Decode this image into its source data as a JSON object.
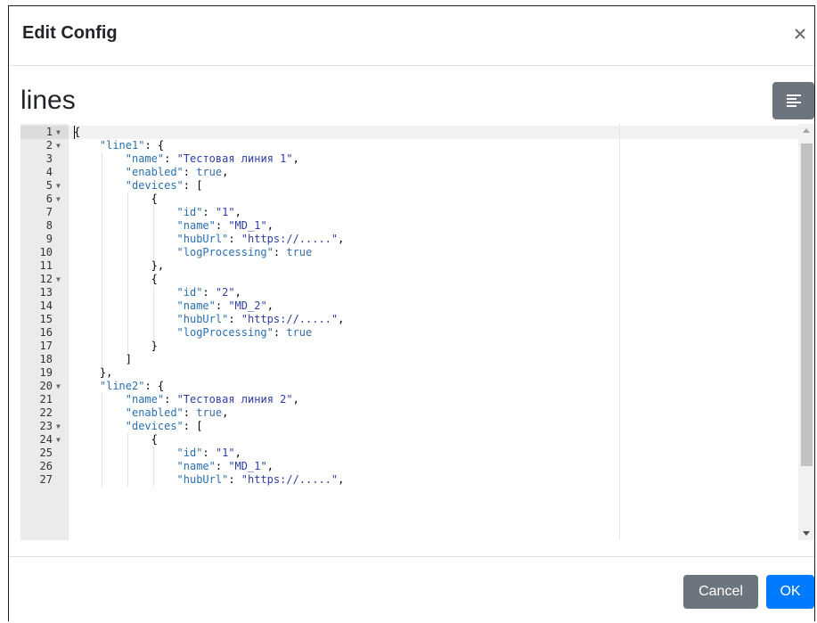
{
  "dialog": {
    "title": "Edit Config",
    "close_glyph": "×",
    "section_title": "lines",
    "format_button_icon": "align-left-icon",
    "cancel_label": "Cancel",
    "ok_label": "OK"
  },
  "colors": {
    "secondary": "#6c757d",
    "primary": "#007bff",
    "json_key": "#2a6fae",
    "json_string": "#2e3da0",
    "gutter": "#ebebeb"
  },
  "editor": {
    "lines": [
      {
        "num": "1",
        "fold": true,
        "indent": 0,
        "tokens": [
          {
            "t": "p",
            "v": "{"
          }
        ]
      },
      {
        "num": "2",
        "fold": true,
        "indent": 1,
        "tokens": [
          {
            "t": "k",
            "v": "\"line1\""
          },
          {
            "t": "p",
            "v": ": {"
          }
        ]
      },
      {
        "num": "3",
        "fold": false,
        "indent": 2,
        "tokens": [
          {
            "t": "k",
            "v": "\"name\""
          },
          {
            "t": "p",
            "v": ": "
          },
          {
            "t": "s",
            "v": "\"Тестовая линия 1\""
          },
          {
            "t": "p",
            "v": ","
          }
        ]
      },
      {
        "num": "4",
        "fold": false,
        "indent": 2,
        "tokens": [
          {
            "t": "k",
            "v": "\"enabled\""
          },
          {
            "t": "p",
            "v": ": "
          },
          {
            "t": "b",
            "v": "true"
          },
          {
            "t": "p",
            "v": ","
          }
        ]
      },
      {
        "num": "5",
        "fold": true,
        "indent": 2,
        "tokens": [
          {
            "t": "k",
            "v": "\"devices\""
          },
          {
            "t": "p",
            "v": ": ["
          }
        ]
      },
      {
        "num": "6",
        "fold": true,
        "indent": 3,
        "tokens": [
          {
            "t": "p",
            "v": "{"
          }
        ]
      },
      {
        "num": "7",
        "fold": false,
        "indent": 4,
        "tokens": [
          {
            "t": "k",
            "v": "\"id\""
          },
          {
            "t": "p",
            "v": ": "
          },
          {
            "t": "s",
            "v": "\"1\""
          },
          {
            "t": "p",
            "v": ","
          }
        ]
      },
      {
        "num": "8",
        "fold": false,
        "indent": 4,
        "tokens": [
          {
            "t": "k",
            "v": "\"name\""
          },
          {
            "t": "p",
            "v": ": "
          },
          {
            "t": "s",
            "v": "\"MD_1\""
          },
          {
            "t": "p",
            "v": ","
          }
        ]
      },
      {
        "num": "9",
        "fold": false,
        "indent": 4,
        "tokens": [
          {
            "t": "k",
            "v": "\"hubUrl\""
          },
          {
            "t": "p",
            "v": ": "
          },
          {
            "t": "s",
            "v": "\"https://.....\""
          },
          {
            "t": "p",
            "v": ","
          }
        ]
      },
      {
        "num": "10",
        "fold": false,
        "indent": 4,
        "tokens": [
          {
            "t": "k",
            "v": "\"logProcessing\""
          },
          {
            "t": "p",
            "v": ": "
          },
          {
            "t": "b",
            "v": "true"
          }
        ]
      },
      {
        "num": "11",
        "fold": false,
        "indent": 3,
        "tokens": [
          {
            "t": "p",
            "v": "},"
          }
        ]
      },
      {
        "num": "12",
        "fold": true,
        "indent": 3,
        "tokens": [
          {
            "t": "p",
            "v": "{"
          }
        ]
      },
      {
        "num": "13",
        "fold": false,
        "indent": 4,
        "tokens": [
          {
            "t": "k",
            "v": "\"id\""
          },
          {
            "t": "p",
            "v": ": "
          },
          {
            "t": "s",
            "v": "\"2\""
          },
          {
            "t": "p",
            "v": ","
          }
        ]
      },
      {
        "num": "14",
        "fold": false,
        "indent": 4,
        "tokens": [
          {
            "t": "k",
            "v": "\"name\""
          },
          {
            "t": "p",
            "v": ": "
          },
          {
            "t": "s",
            "v": "\"MD_2\""
          },
          {
            "t": "p",
            "v": ","
          }
        ]
      },
      {
        "num": "15",
        "fold": false,
        "indent": 4,
        "tokens": [
          {
            "t": "k",
            "v": "\"hubUrl\""
          },
          {
            "t": "p",
            "v": ": "
          },
          {
            "t": "s",
            "v": "\"https://.....\""
          },
          {
            "t": "p",
            "v": ","
          }
        ]
      },
      {
        "num": "16",
        "fold": false,
        "indent": 4,
        "tokens": [
          {
            "t": "k",
            "v": "\"logProcessing\""
          },
          {
            "t": "p",
            "v": ": "
          },
          {
            "t": "b",
            "v": "true"
          }
        ]
      },
      {
        "num": "17",
        "fold": false,
        "indent": 3,
        "tokens": [
          {
            "t": "p",
            "v": "}"
          }
        ]
      },
      {
        "num": "18",
        "fold": false,
        "indent": 2,
        "tokens": [
          {
            "t": "p",
            "v": "]"
          }
        ]
      },
      {
        "num": "19",
        "fold": false,
        "indent": 1,
        "tokens": [
          {
            "t": "p",
            "v": "},"
          }
        ]
      },
      {
        "num": "20",
        "fold": true,
        "indent": 1,
        "tokens": [
          {
            "t": "k",
            "v": "\"line2\""
          },
          {
            "t": "p",
            "v": ": {"
          }
        ]
      },
      {
        "num": "21",
        "fold": false,
        "indent": 2,
        "tokens": [
          {
            "t": "k",
            "v": "\"name\""
          },
          {
            "t": "p",
            "v": ": "
          },
          {
            "t": "s",
            "v": "\"Тестовая линия 2\""
          },
          {
            "t": "p",
            "v": ","
          }
        ]
      },
      {
        "num": "22",
        "fold": false,
        "indent": 2,
        "tokens": [
          {
            "t": "k",
            "v": "\"enabled\""
          },
          {
            "t": "p",
            "v": ": "
          },
          {
            "t": "b",
            "v": "true"
          },
          {
            "t": "p",
            "v": ","
          }
        ]
      },
      {
        "num": "23",
        "fold": true,
        "indent": 2,
        "tokens": [
          {
            "t": "k",
            "v": "\"devices\""
          },
          {
            "t": "p",
            "v": ": ["
          }
        ]
      },
      {
        "num": "24",
        "fold": true,
        "indent": 3,
        "tokens": [
          {
            "t": "p",
            "v": "{"
          }
        ]
      },
      {
        "num": "25",
        "fold": false,
        "indent": 4,
        "tokens": [
          {
            "t": "k",
            "v": "\"id\""
          },
          {
            "t": "p",
            "v": ": "
          },
          {
            "t": "s",
            "v": "\"1\""
          },
          {
            "t": "p",
            "v": ","
          }
        ]
      },
      {
        "num": "26",
        "fold": false,
        "indent": 4,
        "tokens": [
          {
            "t": "k",
            "v": "\"name\""
          },
          {
            "t": "p",
            "v": ": "
          },
          {
            "t": "s",
            "v": "\"MD_1\""
          },
          {
            "t": "p",
            "v": ","
          }
        ]
      },
      {
        "num": "27",
        "fold": false,
        "indent": 4,
        "tokens": [
          {
            "t": "k",
            "v": "\"hubUrl\""
          },
          {
            "t": "p",
            "v": ": "
          },
          {
            "t": "s",
            "v": "\"https://.....\""
          },
          {
            "t": "p",
            "v": ","
          }
        ]
      }
    ]
  }
}
